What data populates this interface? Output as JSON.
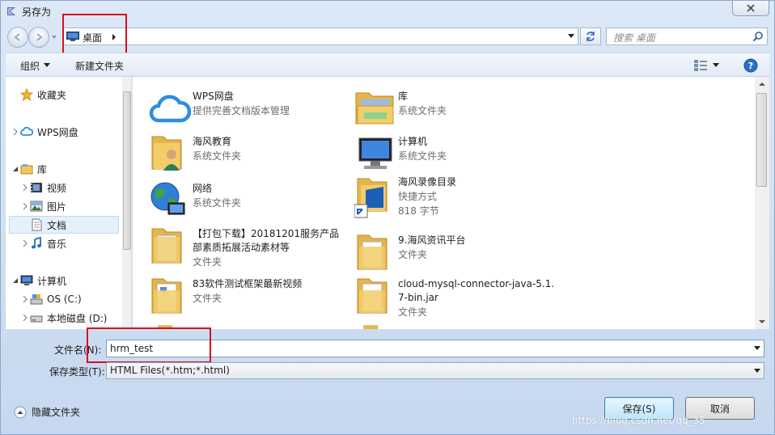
{
  "window": {
    "title": "另存为"
  },
  "address": {
    "location": "桌面",
    "search_placeholder": "搜索 桌面"
  },
  "toolbar": {
    "organize": "组织",
    "new_folder": "新建文件夹"
  },
  "sidebar": {
    "favorites": "收藏夹",
    "wps": "WPS网盘",
    "library": "库",
    "library_items": [
      "视频",
      "图片",
      "文档",
      "音乐"
    ],
    "computer": "计算机",
    "drives": [
      "OS (C:)",
      "本地磁盘 (D:)"
    ]
  },
  "files": [
    {
      "name": "WPS网盘",
      "sub": "提供完善文档版本管理",
      "icon": "cloud-icon"
    },
    {
      "name": "库",
      "sub": "系统文件夹",
      "icon": "library-folder-icon"
    },
    {
      "name": "海风教育",
      "sub": "系统文件夹",
      "icon": "user-folder-icon"
    },
    {
      "name": "计算机",
      "sub": "系统文件夹",
      "icon": "computer-icon"
    },
    {
      "name": "网络",
      "sub": "系统文件夹",
      "icon": "network-globe-icon"
    },
    {
      "name": "海风录像目录",
      "sub": "快捷方式",
      "sub2": "818 字节",
      "icon": "shortcut-folder-icon"
    },
    {
      "name": "【打包下载】20181201服务产品\n部素质拓展活动素材等",
      "sub": "文件夹",
      "icon": "folder-icon"
    },
    {
      "name": "9.海风资讯平台",
      "sub": "文件夹",
      "icon": "folder-icon"
    },
    {
      "name": "83软件测试框架最新视频",
      "sub": "文件夹",
      "icon": "folder-icon"
    },
    {
      "name": "cloud-mysql-connector-java-5.1.\n7-bin.jar",
      "sub": "文件夹",
      "icon": "folder-icon"
    }
  ],
  "form": {
    "filename_label": "文件名(N):",
    "filename_value": "hrm_test",
    "filetype_label": "保存类型(T):",
    "filetype_value": "HTML Files(*.htm;*.html)"
  },
  "footer": {
    "hide_folders": "隐藏文件夹",
    "save": "保存(S)",
    "cancel": "取消",
    "watermark": "https://blog.csdn.net/qq_35"
  },
  "colors": {
    "highlight_red": "#d8101c",
    "folder_yellow": "#f1c75b",
    "accent_blue": "#2b71c6"
  }
}
